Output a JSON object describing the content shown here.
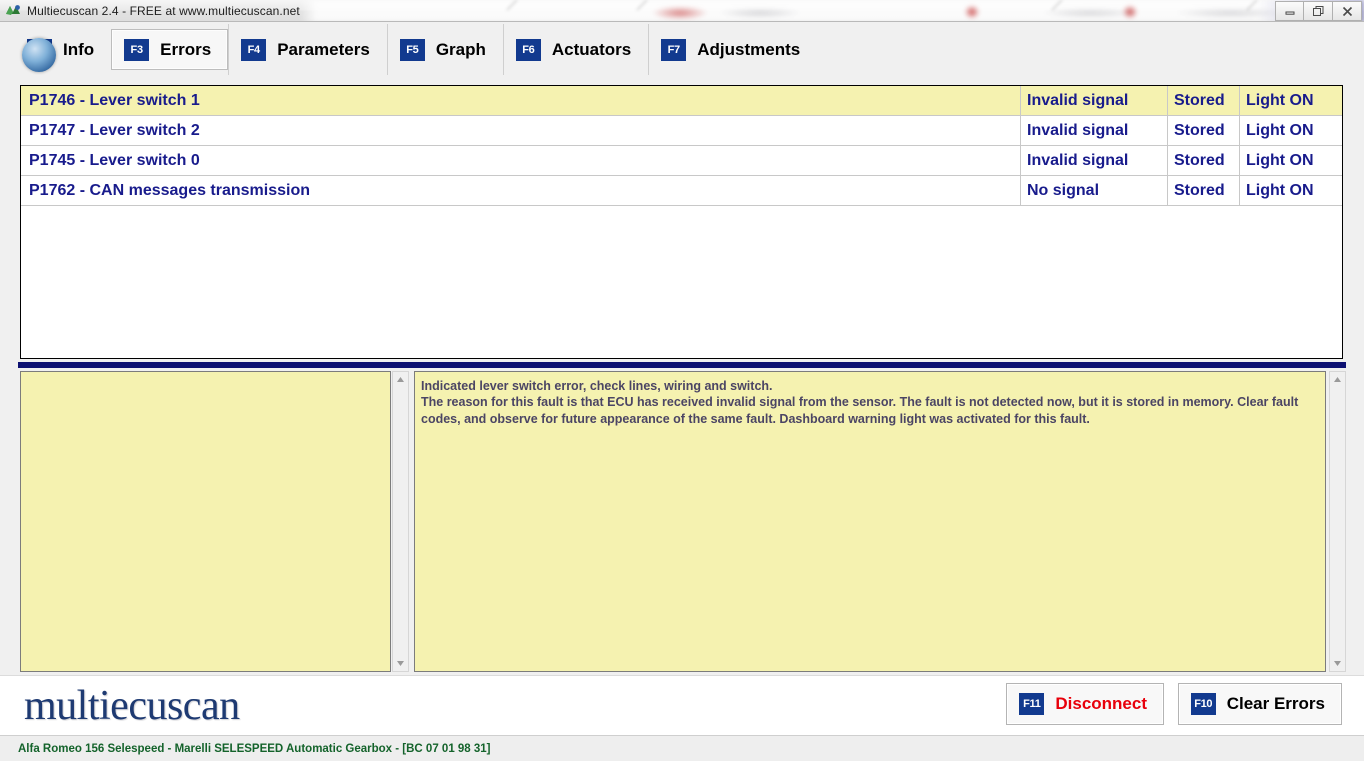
{
  "window": {
    "title": "Multiecuscan 2.4 - FREE at www.multiecuscan.net",
    "app_icon": "multiecuscan-logo-icon",
    "minimize_icon": "minimize-icon",
    "restore_icon": "restore-icon",
    "close_icon": "close-icon"
  },
  "tabs": [
    {
      "key": "F2",
      "label": "Info",
      "active": false
    },
    {
      "key": "F3",
      "label": "Errors",
      "active": true
    },
    {
      "key": "F4",
      "label": "Parameters",
      "active": false
    },
    {
      "key": "F5",
      "label": "Graph",
      "active": false
    },
    {
      "key": "F6",
      "label": "Actuators",
      "active": false
    },
    {
      "key": "F7",
      "label": "Adjustments",
      "active": false
    }
  ],
  "error_table": {
    "rows": [
      {
        "code": "P1746 - Lever switch 1",
        "state": "Invalid signal",
        "stored": "Stored",
        "light": "Light ON",
        "selected": true
      },
      {
        "code": "P1747 - Lever switch 2",
        "state": "Invalid signal",
        "stored": "Stored",
        "light": "Light ON",
        "selected": false
      },
      {
        "code": "P1745 - Lever switch 0",
        "state": "Invalid signal",
        "stored": "Stored",
        "light": "Light ON",
        "selected": false
      },
      {
        "code": "P1762 - CAN messages transmission",
        "state": "No signal",
        "stored": "Stored",
        "light": "Light ON",
        "selected": false
      }
    ]
  },
  "left_panel": {
    "text": ""
  },
  "description": {
    "text": "Indicated lever switch error, check lines, wiring and switch.\nThe reason for this fault is that ECU has received invalid signal from the sensor. The fault is not detected now, but it is stored in memory. Clear fault codes, and observe for future appearance of the same fault. Dashboard warning light was activated for this fault."
  },
  "scrollbars": {
    "up_arrow_icon": "scroll-up-arrow-icon",
    "down_arrow_icon": "scroll-down-arrow-icon"
  },
  "footer": {
    "logo_text": "multiecuscan",
    "buttons": [
      {
        "key": "F11",
        "label": "Disconnect",
        "style": "danger"
      },
      {
        "key": "F10",
        "label": "Clear Errors",
        "style": "normal"
      }
    ]
  },
  "statusbar": {
    "text": "Alfa Romeo 156 Selespeed - Marelli SELESPEED Automatic Gearbox - [BC 07 01 98 31]"
  },
  "colors": {
    "fkey_blue": "#123a8f",
    "row_text_navy": "#181b8c",
    "highlight_yellow": "#f5f2b0",
    "divider_navy": "#0d1172",
    "disconnect_red": "#e8000b",
    "status_green": "#14632b",
    "logo_blue": "#1e3a72"
  }
}
